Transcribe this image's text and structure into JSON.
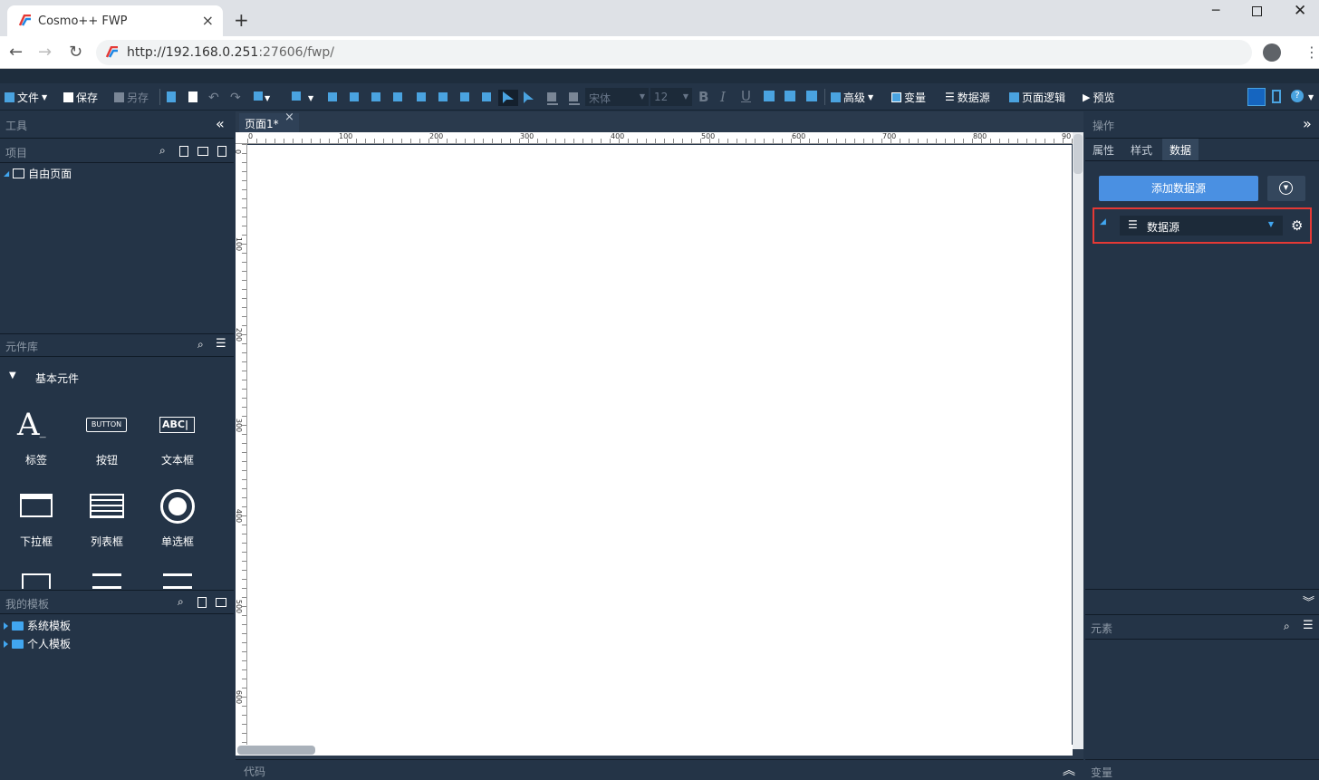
{
  "browser": {
    "tab_title": "Cosmo++ FWP",
    "url_host": "http://192.168.0.251",
    "url_rest": ":27606/fwp/"
  },
  "toolbar": {
    "file": "文件",
    "save": "保存",
    "save_as": "另存",
    "font_name": "宋体",
    "font_size": "12",
    "advanced": "高级",
    "variable": "变量",
    "datasource": "数据源",
    "page_logic": "页面逻辑",
    "preview": "预览",
    "help": "?"
  },
  "left": {
    "tools": "工具",
    "project": "项目",
    "free_page": "自由页面",
    "component_lib": "元件库",
    "basic_components": "基本元件",
    "components": [
      {
        "label": "标签"
      },
      {
        "label": "按钮"
      },
      {
        "label": "文本框"
      },
      {
        "label": "下拉框"
      },
      {
        "label": "列表框"
      },
      {
        "label": "单选框"
      }
    ],
    "button_icon_text": "BUTTON",
    "textbox_icon_text": "ABC",
    "label_icon_text": "A",
    "my_templates": "我的模板",
    "templates": [
      {
        "label": "系统模板"
      },
      {
        "label": "个人模板"
      }
    ]
  },
  "canvas": {
    "page_tab": "页面1*",
    "close": "×",
    "ruler_top": [
      "0",
      "100",
      "200",
      "300",
      "400",
      "500",
      "600",
      "700",
      "800",
      "90"
    ],
    "ruler_left": [
      "0",
      "100",
      "200",
      "300",
      "400",
      "500",
      "600"
    ],
    "code_label": "代码"
  },
  "right": {
    "operation": "操作",
    "tabs": [
      "属性",
      "样式",
      "数据"
    ],
    "add_datasource": "添加数据源",
    "datasource_item": "数据源",
    "elements": "元素",
    "variables": "变量"
  }
}
